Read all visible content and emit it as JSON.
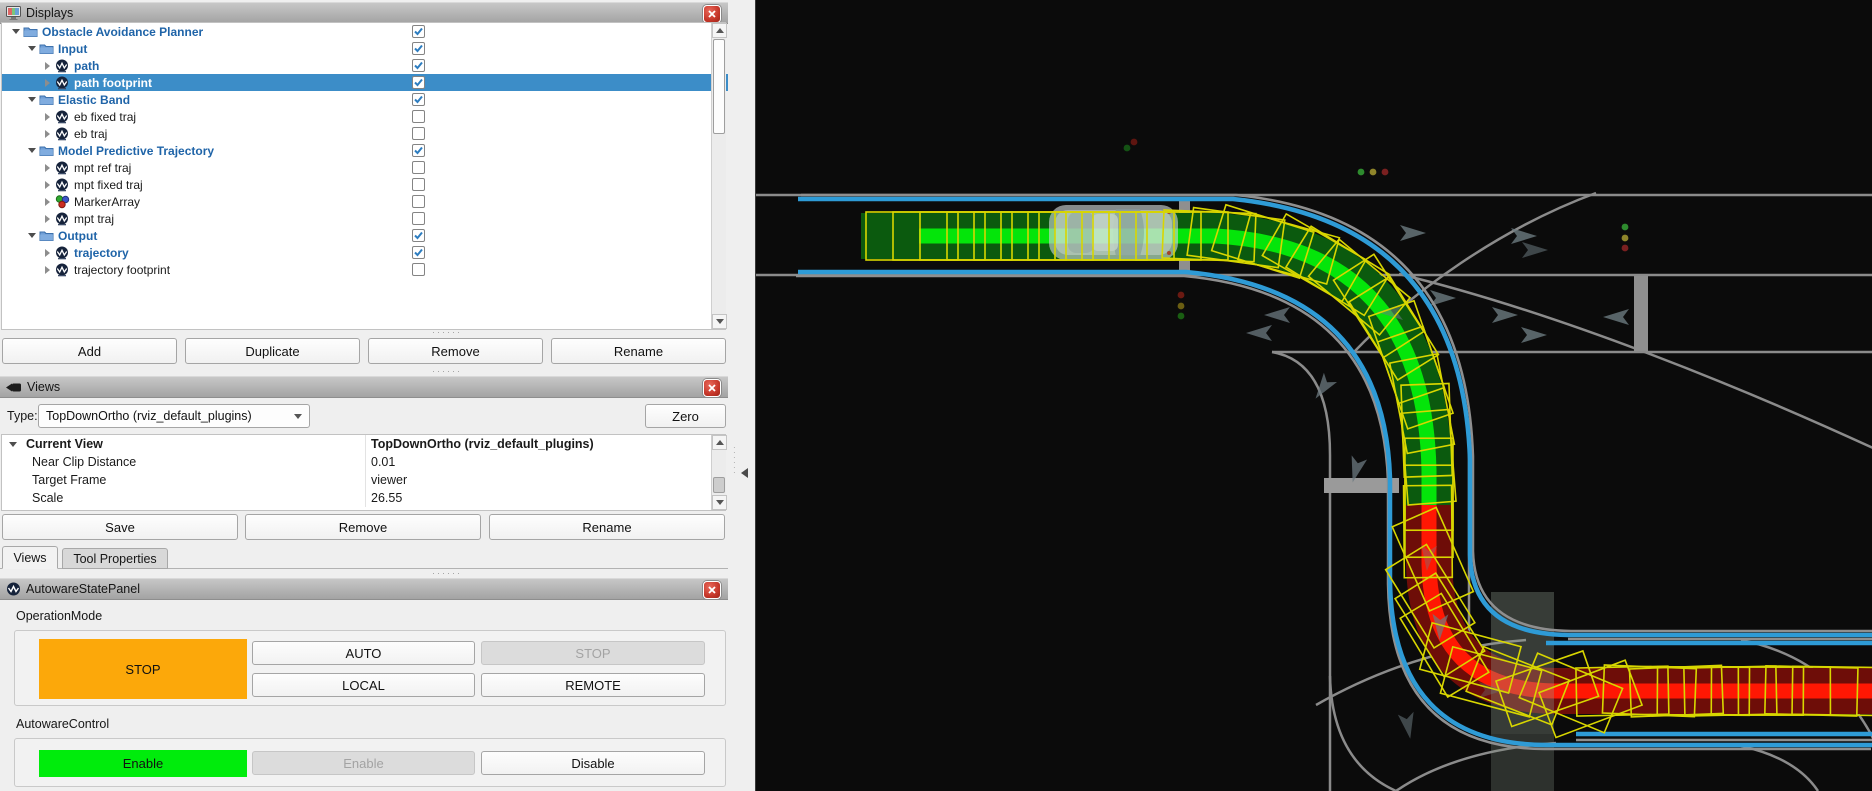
{
  "displays_panel": {
    "title": "Displays",
    "buttons": [
      "Add",
      "Duplicate",
      "Remove",
      "Rename"
    ],
    "tree": [
      {
        "label": "Obstacle Avoidance Planner",
        "level": 0,
        "icon": "folder",
        "expander": "down",
        "checked": true,
        "blue": true,
        "selected": false
      },
      {
        "label": "Input",
        "level": 1,
        "icon": "folder",
        "expander": "down",
        "checked": true,
        "blue": true,
        "selected": false
      },
      {
        "label": "path",
        "level": 2,
        "icon": "autoware",
        "expander": "right",
        "checked": true,
        "blue": true,
        "selected": false
      },
      {
        "label": "path footprint",
        "level": 2,
        "icon": "autoware",
        "expander": "right",
        "checked": true,
        "blue": false,
        "selected": true
      },
      {
        "label": "Elastic Band",
        "level": 1,
        "icon": "folder",
        "expander": "down",
        "checked": true,
        "blue": true,
        "selected": false
      },
      {
        "label": "eb fixed traj",
        "level": 2,
        "icon": "autoware",
        "expander": "right",
        "checked": false,
        "blue": false,
        "selected": false
      },
      {
        "label": "eb traj",
        "level": 2,
        "icon": "autoware",
        "expander": "right",
        "checked": false,
        "blue": false,
        "selected": false
      },
      {
        "label": "Model Predictive Trajectory",
        "level": 1,
        "icon": "folder",
        "expander": "down",
        "checked": true,
        "blue": true,
        "selected": false
      },
      {
        "label": "mpt ref traj",
        "level": 2,
        "icon": "autoware",
        "expander": "right",
        "checked": false,
        "blue": false,
        "selected": false
      },
      {
        "label": "mpt fixed traj",
        "level": 2,
        "icon": "autoware",
        "expander": "right",
        "checked": false,
        "blue": false,
        "selected": false
      },
      {
        "label": "MarkerArray",
        "level": 2,
        "icon": "markers",
        "expander": "right",
        "checked": false,
        "blue": false,
        "selected": false
      },
      {
        "label": "mpt traj",
        "level": 2,
        "icon": "autoware",
        "expander": "right",
        "checked": false,
        "blue": false,
        "selected": false
      },
      {
        "label": "Output",
        "level": 1,
        "icon": "folder",
        "expander": "down",
        "checked": true,
        "blue": true,
        "selected": false
      },
      {
        "label": "trajectory",
        "level": 2,
        "icon": "autoware",
        "expander": "right",
        "checked": true,
        "blue": true,
        "selected": false
      },
      {
        "label": "trajectory footprint",
        "level": 2,
        "icon": "autoware",
        "expander": "right",
        "checked": false,
        "blue": false,
        "selected": false
      }
    ]
  },
  "views_panel": {
    "title": "Views",
    "type_label": "Type:",
    "type_value": "TopDownOrtho (rviz_default_plugins)",
    "zero_button": "Zero",
    "properties": [
      {
        "name": "Current View",
        "value": "TopDownOrtho (rviz_default_plugins)",
        "bold": true,
        "expander": true
      },
      {
        "name": "Near Clip Distance",
        "value": "0.01",
        "bold": false,
        "expander": false
      },
      {
        "name": "Target Frame",
        "value": "viewer",
        "bold": false,
        "expander": false
      },
      {
        "name": "Scale",
        "value": "26.55",
        "bold": false,
        "expander": false
      }
    ],
    "buttons": [
      "Save",
      "Remove",
      "Rename"
    ],
    "tabs": [
      {
        "label": "Views",
        "active": true
      },
      {
        "label": "Tool Properties",
        "active": false
      }
    ]
  },
  "autoware_panel": {
    "title": "AutowareStatePanel",
    "operation_mode": {
      "label": "OperationMode",
      "status": "STOP",
      "status_color": "#fca80a",
      "buttons": [
        {
          "label": "AUTO",
          "enabled": true
        },
        {
          "label": "STOP",
          "enabled": false
        },
        {
          "label": "LOCAL",
          "enabled": true
        },
        {
          "label": "REMOTE",
          "enabled": true
        }
      ]
    },
    "autoware_control": {
      "label": "AutowareControl",
      "status": "Enable",
      "status_color": "#00ec0c",
      "buttons": [
        {
          "label": "Enable",
          "enabled": false
        },
        {
          "label": "Disable",
          "enabled": true
        }
      ]
    }
  },
  "viewport": {
    "background": "#0b0b0b",
    "colors": {
      "road_line_gray": "#8b8b8b",
      "lane_boundary_blue": "#2e9bd6",
      "path_green_dark": "#0b5a0e",
      "path_green_bright": "#04e50a",
      "traj_red_dark": "#6e0d08",
      "traj_red_bright": "#ff1703",
      "footprint_yellow": "#d8d600",
      "ego_body": "#ccd4d4"
    },
    "objects": [
      "lanelet-road-map",
      "ego-vehicle",
      "path-band-green",
      "trajectory-band-red",
      "footprint-outlines",
      "lane-arrows",
      "traffic-lights",
      "stop-line",
      "crosswalk-bar",
      "building-footprint"
    ]
  }
}
